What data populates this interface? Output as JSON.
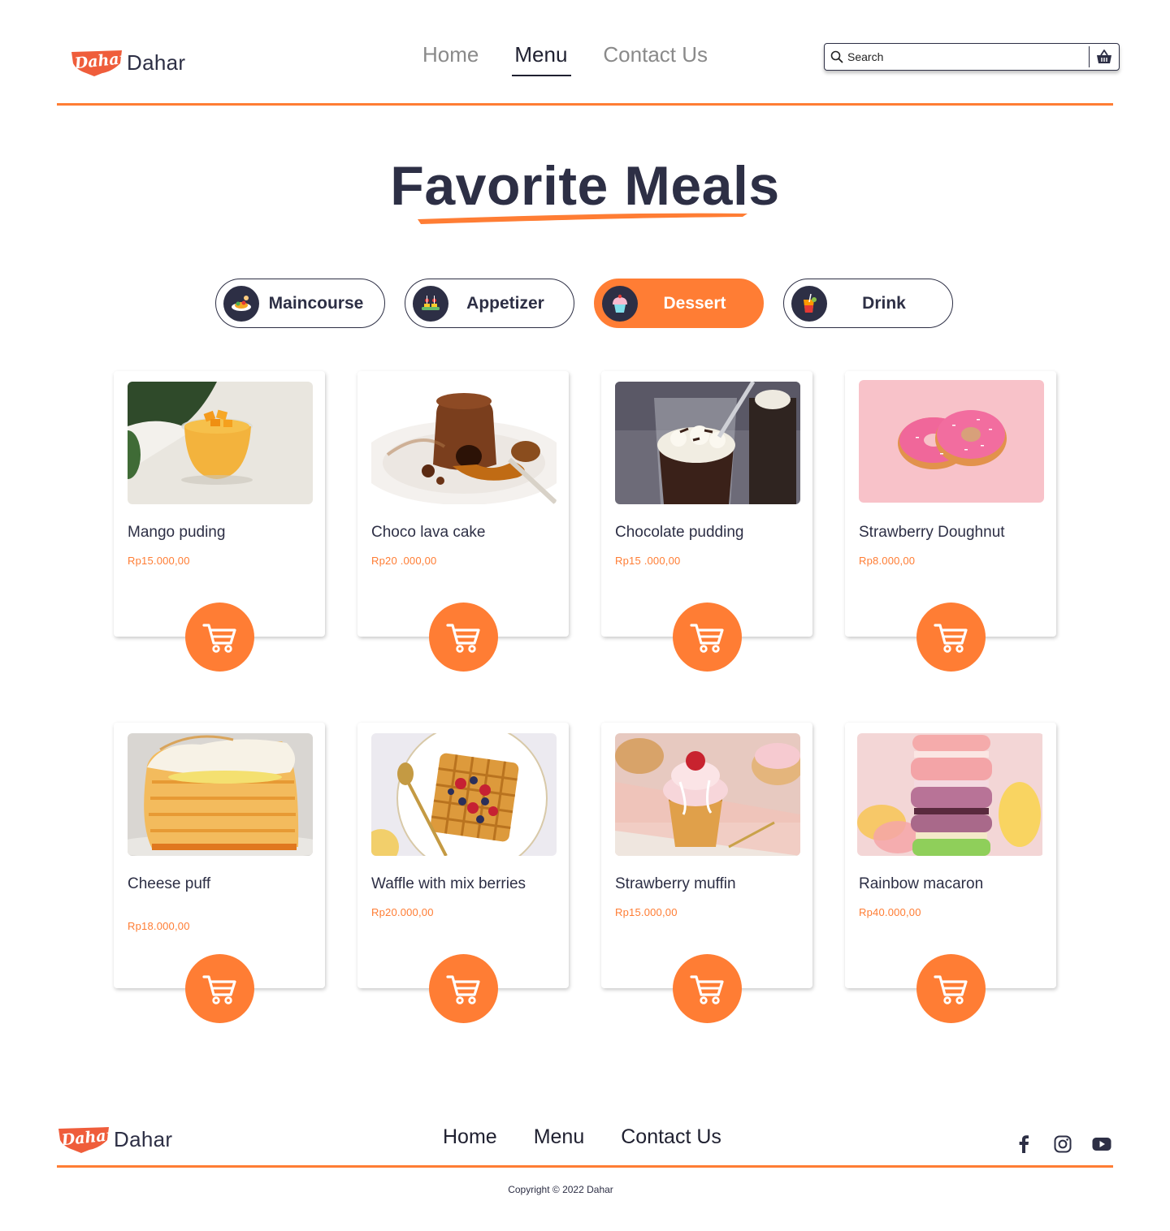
{
  "brand": {
    "name": "Dahar",
    "logo_script": "Dahar"
  },
  "nav": {
    "home": "Home",
    "menu": "Menu",
    "contact": "Contact Us",
    "active": "Menu"
  },
  "search": {
    "placeholder": "Search"
  },
  "hero": {
    "title": "Favorite Meals"
  },
  "categories": [
    {
      "label": "Maincourse",
      "icon": "plate-icon",
      "active": false
    },
    {
      "label": "Appetizer",
      "icon": "canape-icon",
      "active": false
    },
    {
      "label": "Dessert",
      "icon": "cupcake-icon",
      "active": true
    },
    {
      "label": "Drink",
      "icon": "juice-icon",
      "active": false
    }
  ],
  "items": [
    {
      "name": "Mango puding",
      "price": "Rp15.000,00",
      "image": "mango-pudding-photo"
    },
    {
      "name": "Choco lava cake",
      "price": "Rp20 .000,00",
      "image": "lava-cake-photo"
    },
    {
      "name": "Chocolate pudding",
      "price": "Rp15 .000,00",
      "image": "chocolate-pudding-photo"
    },
    {
      "name": "Strawberry Doughnut",
      "price": "Rp8.000,00",
      "image": "doughnut-photo"
    },
    {
      "name": "Cheese puff",
      "price": "Rp18.000,00",
      "image": "cheese-puff-photo"
    },
    {
      "name": "Waffle with mix berries",
      "price": "Rp20.000,00",
      "image": "waffle-photo"
    },
    {
      "name": "Strawberry muffin",
      "price": "Rp15.000,00",
      "image": "muffin-photo"
    },
    {
      "name": "Rainbow macaron",
      "price": "Rp40.000,00",
      "image": "macaron-photo"
    }
  ],
  "footer": {
    "home": "Home",
    "menu": "Menu",
    "contact": "Contact Us",
    "socials": [
      "facebook-icon",
      "instagram-icon",
      "youtube-icon"
    ],
    "copyright": "Copyright © 2022 Dahar"
  },
  "colors": {
    "accent": "#ff7d34",
    "ink": "#2d2f45",
    "muted": "#8a8a8a"
  }
}
